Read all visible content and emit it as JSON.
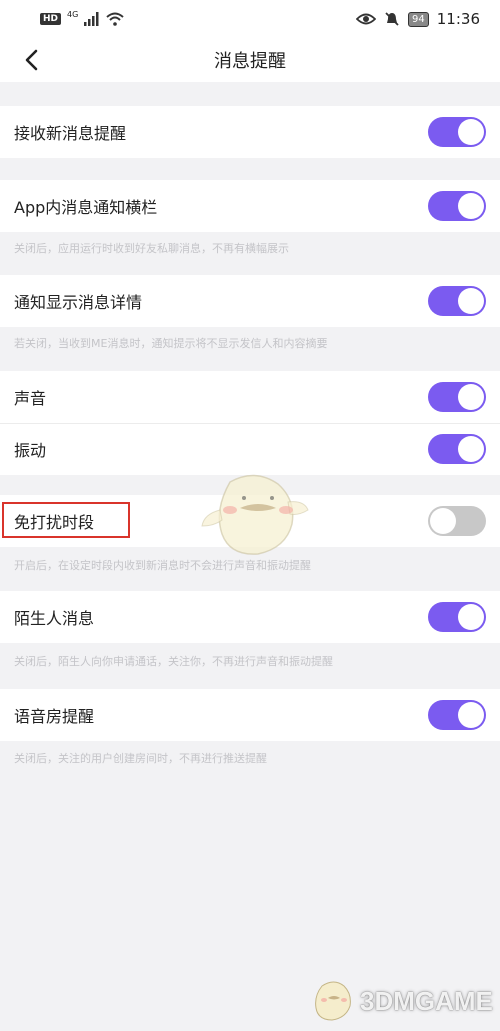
{
  "status_bar": {
    "hd": "HD",
    "network": "4G",
    "battery": "94",
    "time": "11:36"
  },
  "nav": {
    "title": "消息提醒"
  },
  "settings": {
    "receive_new": "接收新消息提醒",
    "in_app_banner": "App内消息通知横栏",
    "in_app_banner_note": "关闭后，应用运行时收到好友私聊消息，不再有横幅展示",
    "show_detail": "通知显示消息详情",
    "show_detail_note": "若关闭，当收到ME消息时，通知提示将不显示发信人和内容摘要",
    "sound": "声音",
    "vibrate": "振动",
    "dnd": "免打扰时段",
    "dnd_note": "开启后，在设定时段内收到新消息时不会进行声音和振动提醒",
    "stranger": "陌生人消息",
    "stranger_note": "关闭后，陌生人向你申请通话，关注你，不再进行声音和振动提醒",
    "voice_room": "语音房提醒",
    "voice_room_note": "关闭后，关注的用户创建房间时，不再进行推送提醒"
  },
  "toggles": {
    "receive_new": true,
    "in_app_banner": true,
    "show_detail": true,
    "sound": true,
    "vibrate": true,
    "dnd": false,
    "stranger": true,
    "voice_room": true
  },
  "watermark": {
    "text": "3DMGAME"
  },
  "colors": {
    "toggle_on": "#7b5bf0",
    "toggle_off": "#c8c8c8",
    "highlight": "#d9342b"
  }
}
